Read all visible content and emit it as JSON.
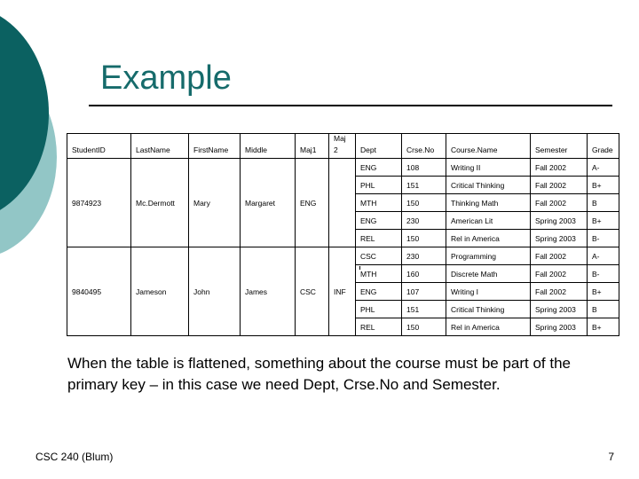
{
  "slide": {
    "title": "Example",
    "theme": {
      "title_color": "#166b6b",
      "circle_dark": "#0b6161",
      "circle_light": "#92c6c6",
      "rule_color": "#000000",
      "table_border": "#000000",
      "text_color": "#000000",
      "background": "#ffffff"
    }
  },
  "table": {
    "headers": {
      "student_id": "StudentID",
      "last_name": "LastName",
      "first_name": "FirstName",
      "middle": "Middle",
      "maj1": "Maj1",
      "maj2_line1": "Maj",
      "maj2_line2": "2",
      "dept": "Dept",
      "crse_no": "Crse.No",
      "course_name": "Course.Name",
      "semester": "Semester",
      "grade": "Grade"
    },
    "students": [
      {
        "student_id": "9874923",
        "last_name": "Mc.Dermott",
        "first_name": "Mary",
        "middle": "Margaret",
        "maj1": "ENG",
        "maj2": "",
        "courses": [
          {
            "dept": "ENG",
            "crse_no": "108",
            "course_name": "Writing II",
            "semester": "Fall 2002",
            "grade": "A-"
          },
          {
            "dept": "PHL",
            "crse_no": "151",
            "course_name": "Critical Thinking",
            "semester": "Fall 2002",
            "grade": "B+"
          },
          {
            "dept": "MTH",
            "crse_no": "150",
            "course_name": "Thinking Math",
            "semester": "Fall 2002",
            "grade": "B"
          },
          {
            "dept": "ENG",
            "crse_no": "230",
            "course_name": "American Lit",
            "semester": "Spring 2003",
            "grade": "B+"
          },
          {
            "dept": "REL",
            "crse_no": "150",
            "course_name": "Rel in America",
            "semester": "Spring 2003",
            "grade": "B-"
          }
        ]
      },
      {
        "student_id": "9840495",
        "last_name": "Jameson",
        "first_name": "John",
        "middle": "James",
        "maj1": "CSC",
        "maj2": "INF",
        "courses": [
          {
            "dept": "CSC",
            "crse_no": "230",
            "course_name": "Programming",
            "semester": "Fall 2002",
            "grade": "A-"
          },
          {
            "dept": "MTH",
            "crse_no": "160",
            "course_name": "Discrete Math",
            "semester": "Fall 2002",
            "grade": "B-"
          },
          {
            "dept": "ENG",
            "crse_no": "107",
            "course_name": "Writing I",
            "semester": "Fall 2002",
            "grade": "B+"
          },
          {
            "dept": "PHL",
            "crse_no": "151",
            "course_name": "Critical Thinking",
            "semester": "Spring 2003",
            "grade": "B"
          },
          {
            "dept": "REL",
            "crse_no": "150",
            "course_name": "Rel in America",
            "semester": "Spring 2003",
            "grade": "B+"
          }
        ]
      }
    ]
  },
  "body": {
    "paragraph": "When the table is flattened, something about the course must be part of the primary key – in this case we need Dept, Crse.No and Semester."
  },
  "footer": {
    "course": "CSC 240 (Blum)",
    "page_number": "7"
  }
}
